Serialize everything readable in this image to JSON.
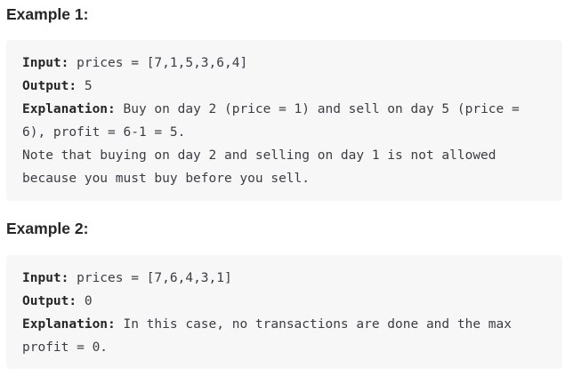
{
  "examples": [
    {
      "heading": "Example 1:",
      "input_label": "Input:",
      "input_value": " prices = [7,1,5,3,6,4]",
      "output_label": "Output:",
      "output_value": " 5",
      "explanation_label": "Explanation:",
      "explanation_lines": [
        " Buy on day 2 (price = 1) and sell on day 5 (price =",
        "6), profit = 6-1 = 5.",
        "Note that buying on day 2 and selling on day 1 is not allowed",
        "because you must buy before you sell."
      ]
    },
    {
      "heading": "Example 2:",
      "input_label": "Input:",
      "input_value": " prices = [7,6,4,3,1]",
      "output_label": "Output:",
      "output_value": " 0",
      "explanation_label": "Explanation:",
      "explanation_lines": [
        " In this case, no transactions are done and the max",
        "profit = 0."
      ]
    }
  ],
  "colors": {
    "heading_text": "#262626",
    "code_text": "#3c3c43",
    "code_background": "#f7f7f8"
  }
}
